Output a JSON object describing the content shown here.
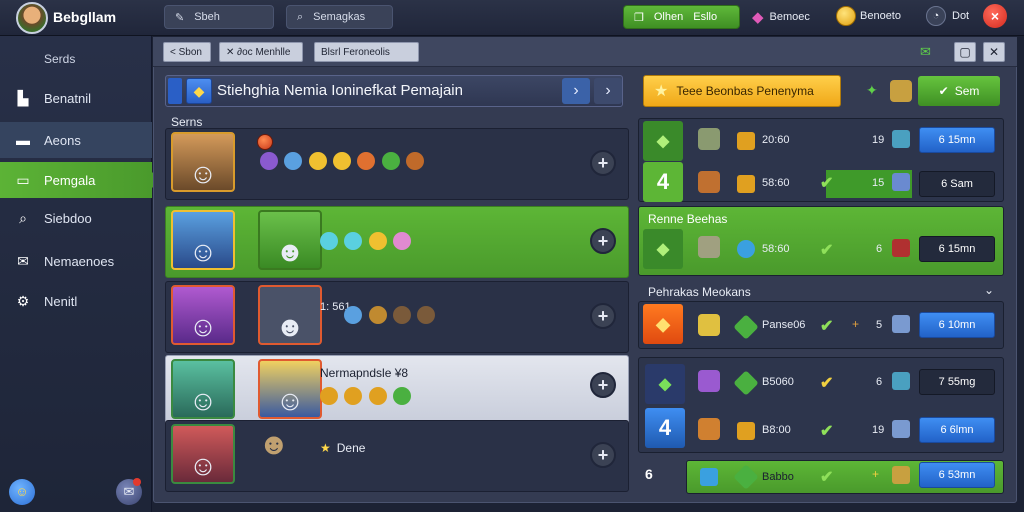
{
  "topbar": {
    "app_title": "Bebgllam",
    "search1": "Sbeh",
    "search2": "Semagkas",
    "status_pill": {
      "label1": "Olhen",
      "label2": "Esllo"
    },
    "gem_label": "Bemoec",
    "gold_label": "Benoeto",
    "dot_label": "Dot",
    "close_label": "×"
  },
  "sidebar": {
    "header": "Serds",
    "items": [
      {
        "label": "Benatnil",
        "icon": "chart-icon"
      },
      {
        "label": "Aeons",
        "icon": "folder-icon"
      },
      {
        "label": "Pemgala",
        "icon": "card-icon"
      },
      {
        "label": "Siebdoo",
        "icon": "search-icon"
      },
      {
        "label": "Nemaenoes",
        "icon": "envelope-icon"
      },
      {
        "label": "Nenitl",
        "icon": "gear-icon"
      }
    ]
  },
  "tabs": [
    {
      "label": "< Sbon"
    },
    {
      "label": "✕ ∂oc Menhlle"
    },
    {
      "label": "Blsrl Feroneolis"
    }
  ],
  "header": {
    "title": "Stiehghia Nemia Ioninefkat Pemajain",
    "prev": "›",
    "next": "›"
  },
  "left_section_label": "Serns",
  "left_rows": [
    {
      "style": "dark",
      "items_text": ""
    },
    {
      "style": "green",
      "items_text": ""
    },
    {
      "style": "dark",
      "items_text": "1: 561"
    },
    {
      "style": "light",
      "items_text": "Nermapndsle ¥8"
    },
    {
      "style": "dark",
      "items_text": "Dene"
    }
  ],
  "promo_label": "Teee Beonbas Penenyma",
  "save_label": "Sem",
  "right_rows": [
    {
      "num": "20:60",
      "count": "19",
      "btn": "6 15mn",
      "btn_style": "blue"
    },
    {
      "num": "58:60",
      "count": "15",
      "btn": "6 Sam",
      "btn_style": "dark"
    },
    {
      "num": "58:60",
      "count": "6",
      "btn": "6 15mn",
      "btn_style": "dark"
    },
    {
      "num": "Panse06",
      "count": "5",
      "btn": "6 10mn",
      "btn_style": "blue"
    },
    {
      "num": "B5060",
      "count": "6",
      "btn": "7 55mg",
      "btn_style": "dark"
    },
    {
      "num": "B8:00",
      "count": "19",
      "btn": "6 6lmn",
      "btn_style": "blue"
    },
    {
      "num": "Babbo",
      "count": "",
      "btn": "6 53mn",
      "btn_style": "blue"
    }
  ],
  "right_section1_label": "Renne Beehas",
  "right_section2_label": "Pehrakas Meokans",
  "big_numbers": [
    "4",
    "4",
    "6"
  ],
  "colors": {
    "accent_green": "#5db636",
    "accent_blue": "#3f8ef2",
    "gold": "#f0a818",
    "bg": "#1c2234"
  }
}
